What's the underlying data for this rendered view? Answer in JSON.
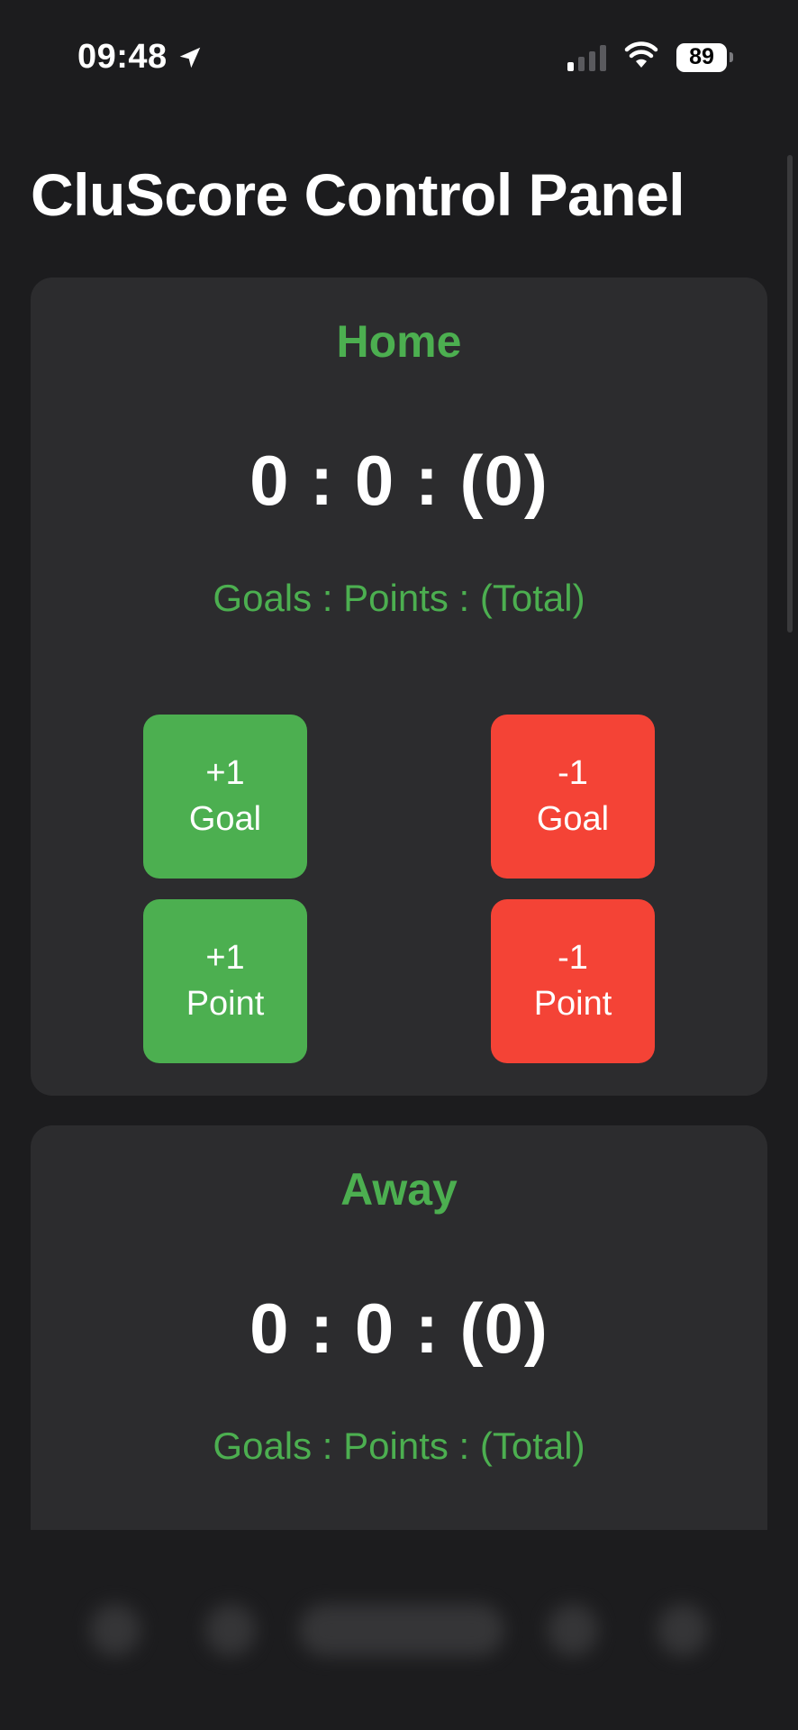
{
  "status_bar": {
    "time": "09:48",
    "battery": "89",
    "icons": [
      "location-arrow-icon",
      "cellular-signal-icon",
      "wifi-icon",
      "battery-icon"
    ]
  },
  "title": "CluScore Control Panel",
  "colors": {
    "background": "#1c1c1e",
    "card": "#2c2c2e",
    "accent_green": "#4caf50",
    "danger_red": "#f44336"
  },
  "home": {
    "name": "Home",
    "score": "0 : 0 : (0)",
    "legend": "Goals : Points : (Total)",
    "buttons": {
      "add_goal": {
        "line1": "+1",
        "line2": "Goal"
      },
      "sub_goal": {
        "line1": "-1",
        "line2": "Goal"
      },
      "add_point": {
        "line1": "+1",
        "line2": "Point"
      },
      "sub_point": {
        "line1": "-1",
        "line2": "Point"
      }
    }
  },
  "away": {
    "name": "Away",
    "score": "0 : 0 : (0)",
    "legend": "Goals : Points : (Total)"
  }
}
